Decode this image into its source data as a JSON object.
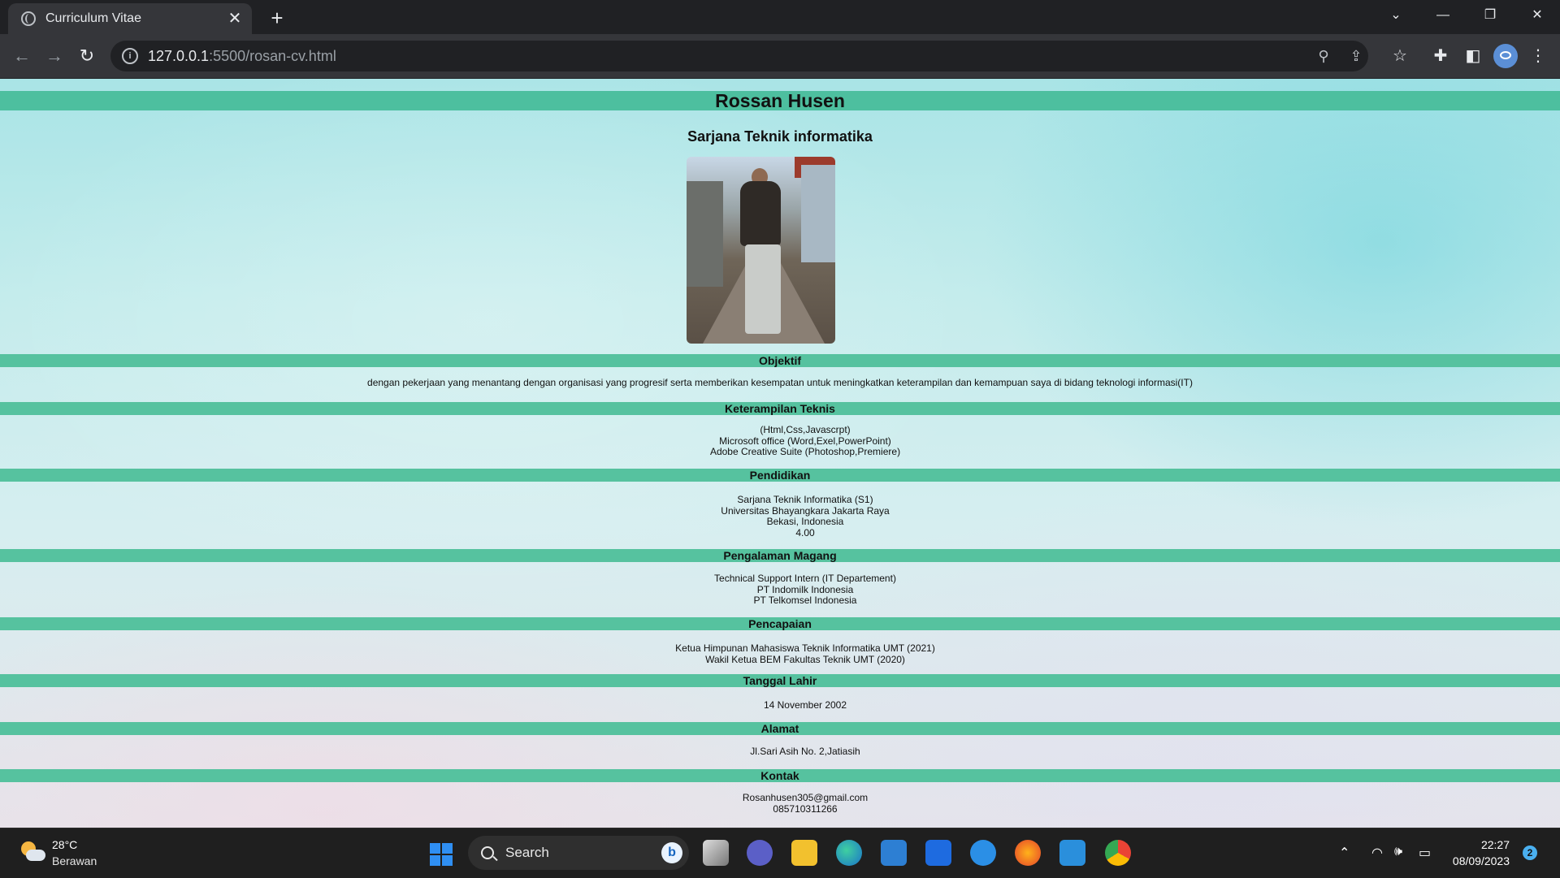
{
  "browser": {
    "tab_title": "Curriculum Vitae",
    "url_host": "127.0.0.1",
    "url_rest": ":5500/rosan-cv.html"
  },
  "cv": {
    "name": "Rossan Husen",
    "degree": "Sarjana Teknik informatika",
    "sections": [
      {
        "heading": "Objektif",
        "lines": [
          "dengan pekerjaan yang menantang dengan organisasi yang progresif serta memberikan kesempatan untuk meningkatkan keterampilan dan kemampuan saya di bidang teknologi informasi(IT)"
        ]
      },
      {
        "heading": "Keterampilan Teknis",
        "lines": [
          "(Html,Css,Javascrpt)",
          "Microsoft office (Word,Exel,PowerPoint)",
          "Adobe Creative Suite (Photoshop,Premiere)"
        ]
      },
      {
        "heading": "Pendidikan",
        "lines": [
          "Sarjana Teknik Informatika (S1)",
          "Universitas Bhayangkara Jakarta Raya",
          "Bekasi, Indonesia",
          "4.00"
        ]
      },
      {
        "heading": "Pengalaman Magang",
        "lines": [
          "Technical Support Intern (IT Departement)",
          "PT Indomilk Indonesia",
          "PT Telkomsel Indonesia"
        ]
      },
      {
        "heading": "Pencapaian",
        "lines": [
          "Ketua Himpunan Mahasiswa Teknik Informatika UMT (2021)",
          "Wakil Ketua BEM Fakultas Teknik UMT (2020)"
        ]
      },
      {
        "heading": "Tanggal Lahir",
        "lines": [
          "14 November 2002"
        ]
      },
      {
        "heading": "Alamat",
        "lines": [
          "Jl.Sari Asih No. 2,Jatiasih"
        ]
      },
      {
        "heading": "Kontak",
        "lines": [
          "Rosanhusen305@gmail.com",
          "085710311266"
        ]
      }
    ]
  },
  "taskbar": {
    "weather_temp": "28°C",
    "weather_desc": "Berawan",
    "search_label": "Search",
    "time": "22:27",
    "date": "08/09/2023",
    "notification_count": "2"
  }
}
